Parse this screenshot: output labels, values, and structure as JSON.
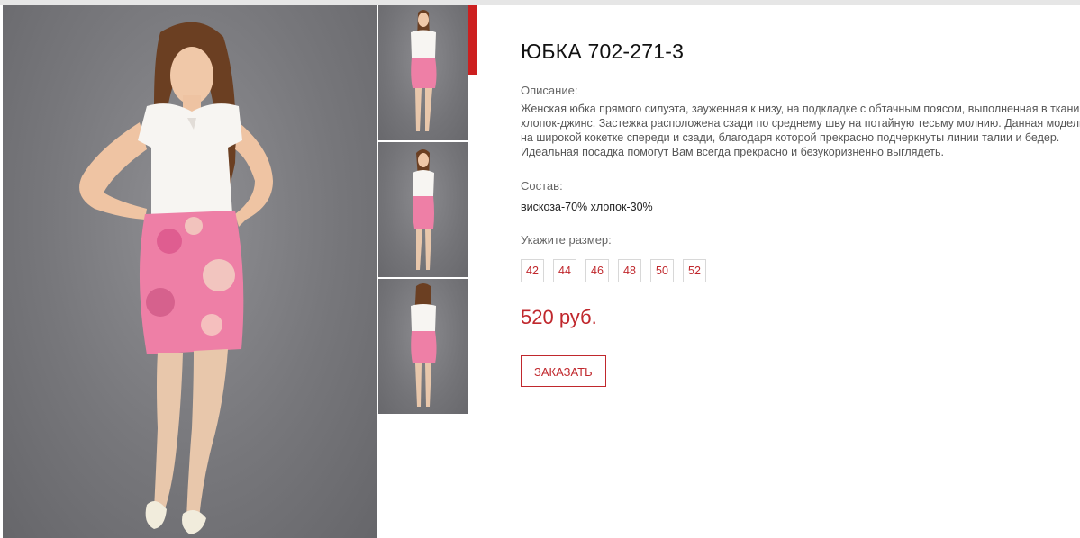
{
  "product": {
    "title": "ЮБКА 702-271-3",
    "description_label": "Описание:",
    "description": "Женская юбка прямого силуэта, зауженная к низу, на подкладке с обтачным поясом, выполненная в ткани хлопок-джинс. Застежка расположена сзади по среднему шву на потайную тесьму молнию. Данная модель на широкой кокетке спереди и сзади, благодаря которой прекрасно подчеркнуты линии талии и бедер. Идеальная посадка помогут Вам всегда прекрасно и безукоризненно выглядеть.",
    "composition_label": "Состав:",
    "composition": "вискоза-70% хлопок-30%",
    "size_label": "Укажите размер:",
    "sizes": [
      "42",
      "44",
      "46",
      "48",
      "50",
      "52"
    ],
    "price": "520 руб.",
    "order_button": "ЗАКАЗАТЬ"
  },
  "colors": {
    "accent": "#c0282d",
    "accent_bar": "#cc1f1f"
  }
}
